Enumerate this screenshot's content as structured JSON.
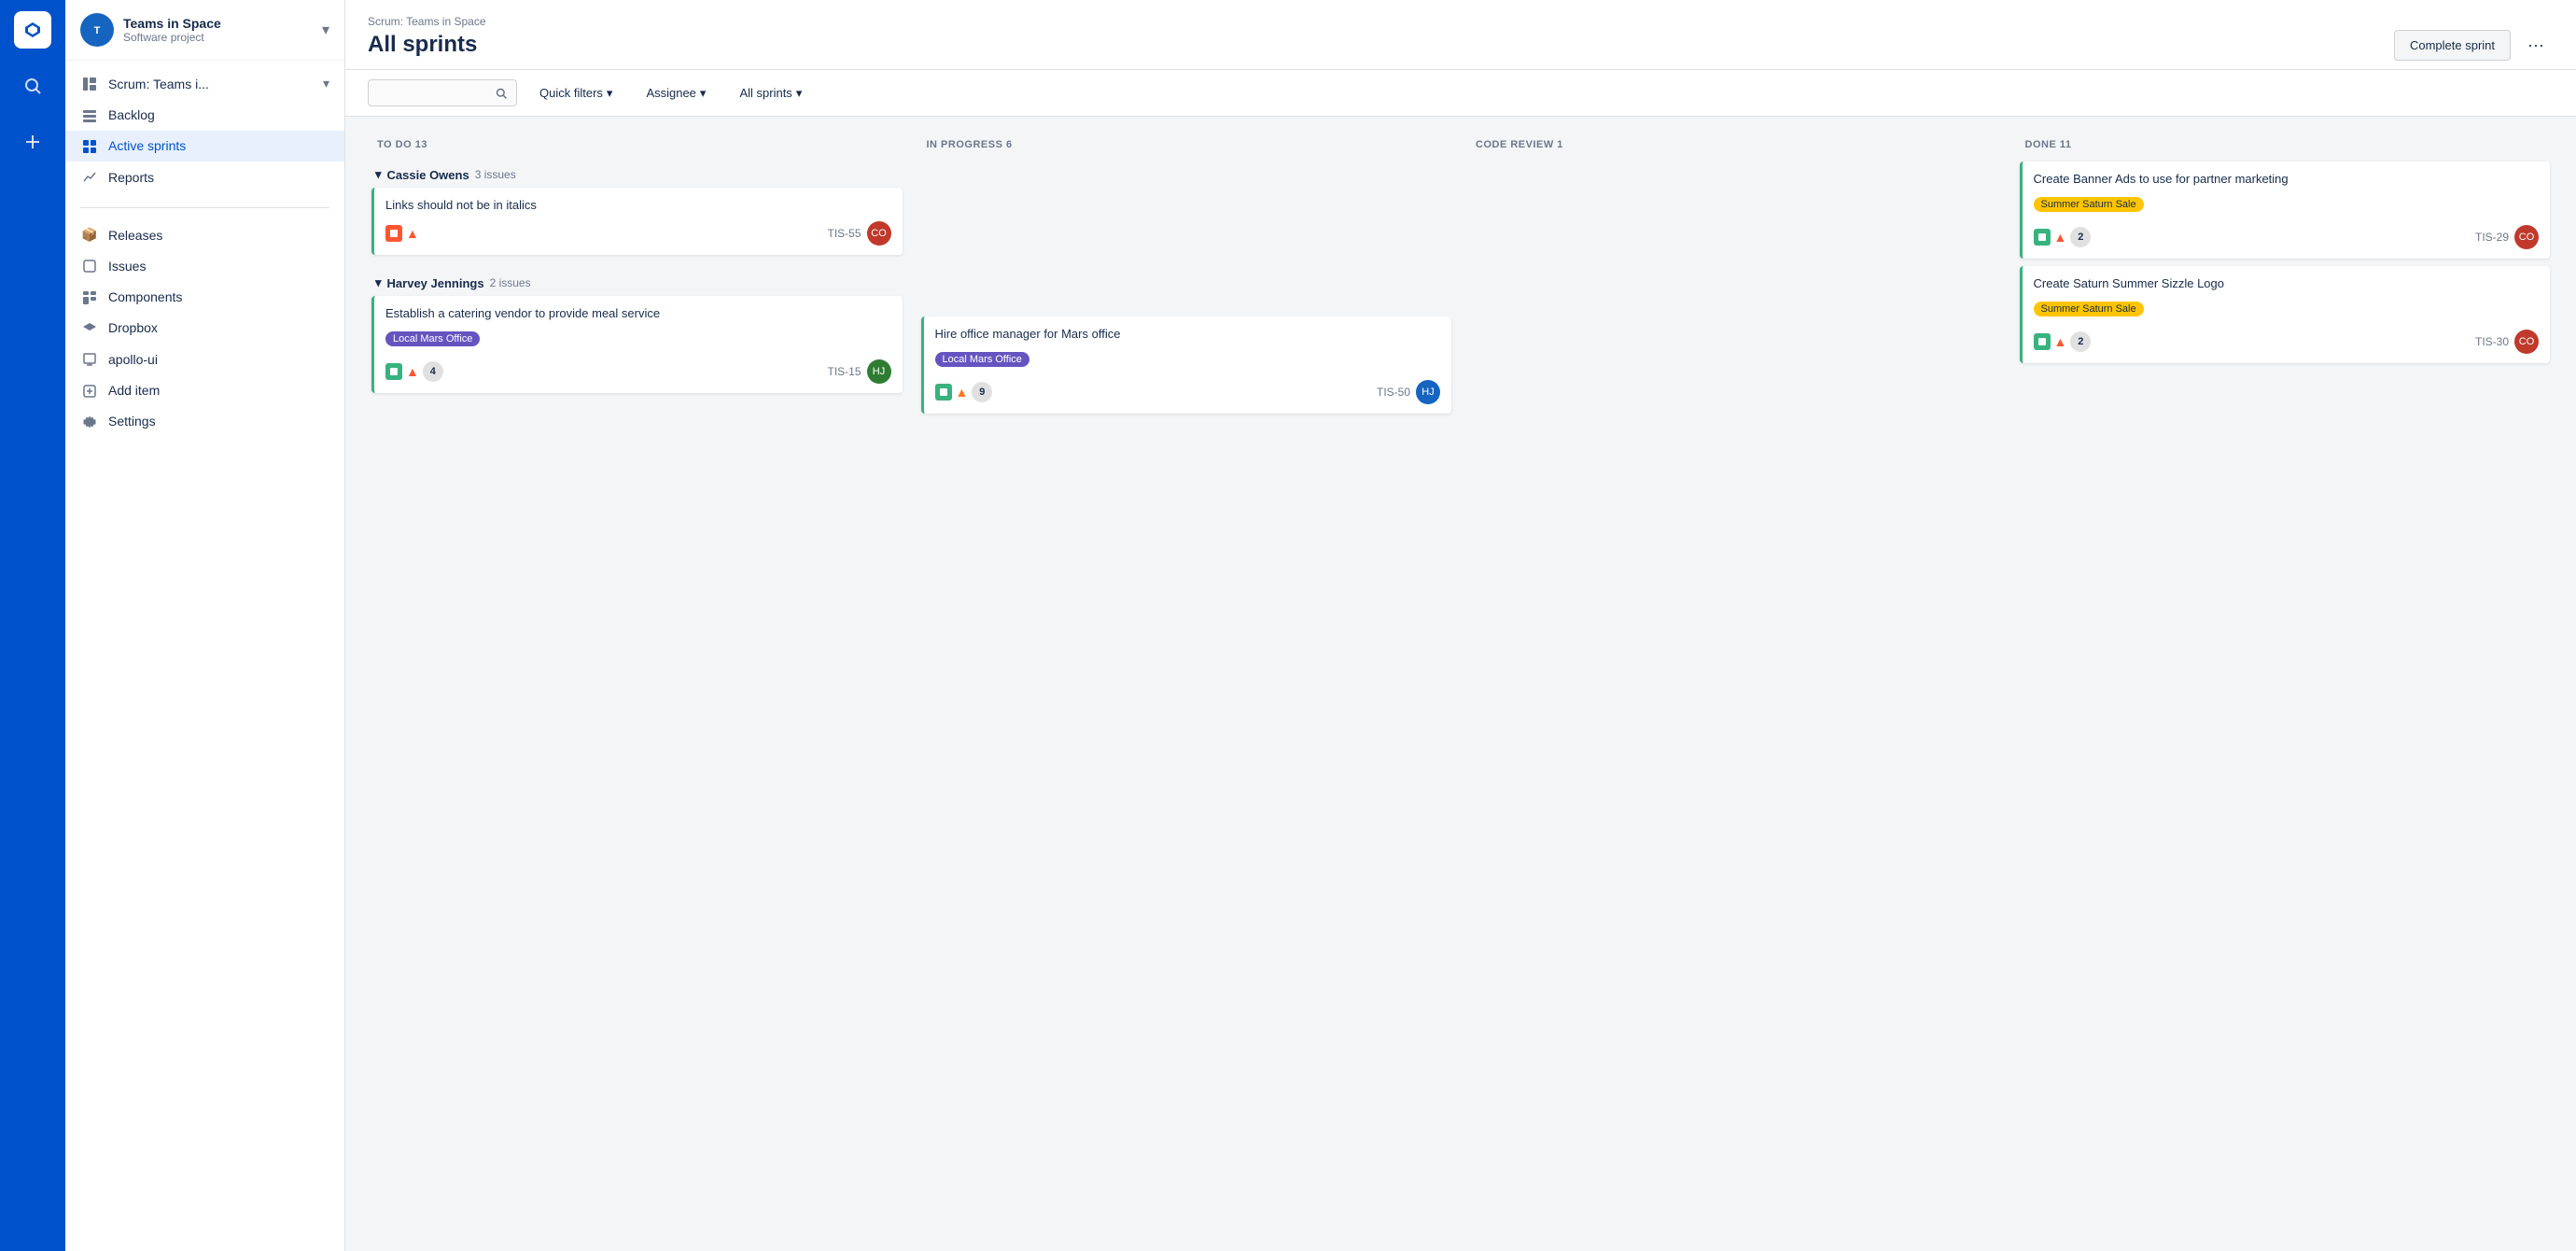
{
  "app": {
    "logo_letter": "◆"
  },
  "icon_nav": {
    "items": [
      {
        "name": "home-icon",
        "symbol": "◆"
      },
      {
        "name": "search-icon",
        "symbol": "🔍"
      },
      {
        "name": "create-icon",
        "symbol": "+"
      }
    ]
  },
  "sidebar": {
    "project_name": "Teams in Space",
    "project_type": "Software project",
    "nav_items": [
      {
        "id": "scrum",
        "label": "Scrum: Teams i...",
        "icon": "≡≡",
        "active": false,
        "has_chevron": true
      },
      {
        "id": "backlog",
        "label": "Backlog",
        "icon": "☰",
        "active": false
      },
      {
        "id": "active-sprints",
        "label": "Active sprints",
        "icon": "⊞",
        "active": true
      },
      {
        "id": "reports",
        "label": "Reports",
        "icon": "📈",
        "active": false
      }
    ],
    "secondary_items": [
      {
        "id": "releases",
        "label": "Releases",
        "icon": "📦"
      },
      {
        "id": "issues",
        "label": "Issues",
        "icon": "⊡"
      },
      {
        "id": "components",
        "label": "Components",
        "icon": "🗂"
      },
      {
        "id": "dropbox",
        "label": "Dropbox",
        "icon": "◈"
      },
      {
        "id": "apollo-ui",
        "label": "apollo-ui",
        "icon": "🖥"
      },
      {
        "id": "add-item",
        "label": "Add item",
        "icon": "+"
      },
      {
        "id": "settings",
        "label": "Settings",
        "icon": "⚙"
      }
    ]
  },
  "header": {
    "breadcrumb": "Scrum: Teams in Space",
    "page_title": "All sprints",
    "complete_sprint_label": "Complete sprint",
    "more_label": "···"
  },
  "toolbar": {
    "search_placeholder": "",
    "filters": [
      {
        "id": "quick-filters",
        "label": "Quick filters"
      },
      {
        "id": "assignee",
        "label": "Assignee"
      },
      {
        "id": "all-sprints",
        "label": "All sprints"
      }
    ]
  },
  "columns": [
    {
      "id": "todo",
      "label": "TO DO",
      "count": 13
    },
    {
      "id": "inprogress",
      "label": "IN PROGRESS",
      "count": 6
    },
    {
      "id": "codereview",
      "label": "CODE REVIEW",
      "count": 1
    },
    {
      "id": "done",
      "label": "DONE",
      "count": 11
    }
  ],
  "swimlanes": [
    {
      "id": "cassie-owens",
      "assignee": "Cassie Owens",
      "issue_count": 3,
      "issue_label": "issues",
      "cards": {
        "todo": [
          {
            "id": "card-55",
            "title": "Links should not be in italics",
            "ticket_id": "TIS-55",
            "border": "border-green",
            "has_story_icon": true,
            "story_icon_color": "red",
            "has_priority": true,
            "priority_color": "red",
            "badge": null,
            "avatar_initials": "CO"
          }
        ],
        "inprogress": [],
        "codereview": [],
        "done": [
          {
            "id": "card-29",
            "title": "Create Banner Ads to use for partner marketing",
            "ticket_id": "TIS-29",
            "border": "border-green",
            "tag": "Summer Saturn Sale",
            "tag_color": "yellow",
            "has_story_icon": true,
            "story_icon_color": "green",
            "has_priority": true,
            "priority_color": "red",
            "badge": 2,
            "avatar_initials": "CO"
          },
          {
            "id": "card-30",
            "title": "Create Saturn Summer Sizzle Logo",
            "ticket_id": "TIS-30",
            "border": "border-green",
            "tag": "Summer Saturn Sale",
            "tag_color": "yellow",
            "has_story_icon": true,
            "story_icon_color": "green",
            "has_priority": true,
            "priority_color": "red",
            "badge": 2,
            "avatar_initials": "CO"
          }
        ]
      }
    },
    {
      "id": "harvey-jennings",
      "assignee": "Harvey Jennings",
      "issue_count": 2,
      "issue_label": "issues",
      "cards": {
        "todo": [
          {
            "id": "card-15",
            "title": "Establish a catering vendor to provide meal service",
            "ticket_id": "TIS-15",
            "border": "border-green",
            "tag": "Local Mars Office",
            "tag_color": "purple",
            "has_story_icon": true,
            "story_icon_color": "green",
            "has_priority": true,
            "priority_color": "red",
            "badge": 4,
            "avatar_initials": "HJ"
          }
        ],
        "inprogress": [
          {
            "id": "card-50",
            "title": "Hire office manager for Mars office",
            "ticket_id": "TIS-50",
            "border": "border-green",
            "tag": "Local Mars Office",
            "tag_color": "purple",
            "has_story_icon": true,
            "story_icon_color": "green",
            "has_priority": true,
            "priority_color": "orange",
            "badge": 9,
            "avatar_initials": "HJ"
          }
        ],
        "codereview": [],
        "done": []
      }
    }
  ]
}
